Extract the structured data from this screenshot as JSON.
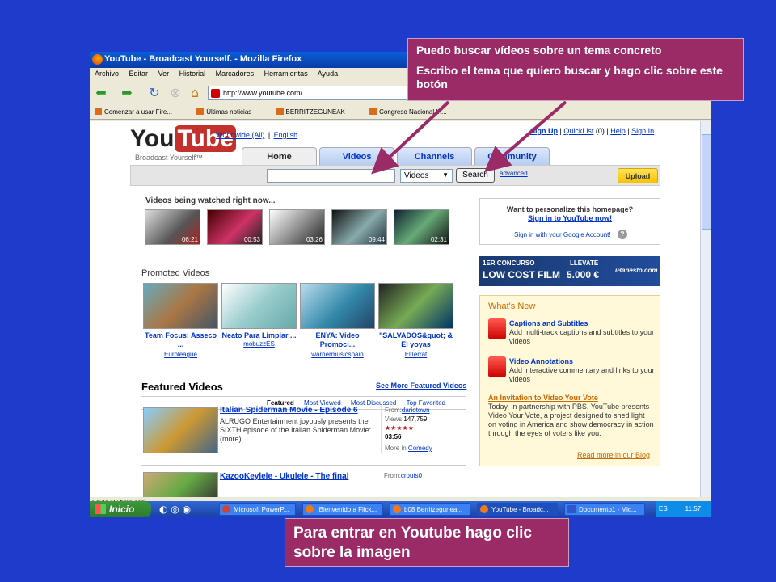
{
  "window": {
    "title": "YouTube - Broadcast Yourself. - Mozilla Firefox"
  },
  "menubar": [
    "Archivo",
    "Editar",
    "Ver",
    "Historial",
    "Marcadores",
    "Herramientas",
    "Ayuda"
  ],
  "address": {
    "url": "http://www.youtube.com/"
  },
  "bookmarks": [
    "Comenzar a usar Fire...",
    "Últimas noticias",
    "BERRITZEGUNEAK",
    "Congreso Nacional In..."
  ],
  "header": {
    "logo_you": "You",
    "logo_tube": "Tube",
    "slogan": "Broadcast Yourself™",
    "worldwide": "Worldwide (All)",
    "sep": "|",
    "english": "English",
    "signup": "Sign Up",
    "quicklist": "QuickList",
    "quicklist_count": "(0)",
    "help": "Help",
    "signin": "Sign In"
  },
  "tabs": [
    "Home",
    "Videos",
    "Channels",
    "Community"
  ],
  "search": {
    "category": "Videos",
    "button": "Search",
    "advanced": "advanced",
    "upload": "Upload"
  },
  "watching": {
    "heading": "Videos being watched right now...",
    "durations": [
      "06:21",
      "00:53",
      "03:26",
      "09:44",
      "02:31"
    ]
  },
  "personalize": {
    "text": "Want to personalize this homepage?",
    "signin": "Sign in to YouTube now!",
    "google": "Sign in with your Google Account!"
  },
  "promoted": {
    "heading": "Promoted Videos",
    "items": [
      {
        "title": "Team Focus: Asseco ...",
        "user": "Euroleague"
      },
      {
        "title": "Neato Para Limpiar ...",
        "user": "mobuzzES"
      },
      {
        "title": "ENYA: Video Promoci...",
        "user": "warnermusicspain"
      },
      {
        "title": "\"SALVADOS&quot; & El yoyas",
        "user": "ElTerrat"
      }
    ]
  },
  "ad": {
    "line1": "1ER CONCURSO",
    "line2": "LOW COST FILM",
    "line3": "LLÉVATE",
    "line4": "5.000 €",
    "brand": "iBanesto.com"
  },
  "featured": {
    "heading": "Featured Videos",
    "see_more": "See More Featured Videos",
    "tabs": [
      "Featured",
      "Most Viewed",
      "Most Discussed",
      "Top Favorited"
    ],
    "videos": [
      {
        "title": "Italian Spiderman Movie - Episode 6",
        "desc": "ALRUGO Entertainment joyously presents the SIXTH episode of the Italian Spiderman Movie:",
        "more": "(more)",
        "from_label": "From:",
        "from": "dariotown",
        "views_label": "Views:",
        "views": "147,759",
        "stars": "★★★★★",
        "time": "03:56",
        "more_in": "More in",
        "category": "Comedy"
      },
      {
        "title": "KazooKeylele - Ukulele - The final",
        "from_label": "From:",
        "from": "crouts0"
      }
    ]
  },
  "whats_new": {
    "heading": "What's New",
    "items": [
      {
        "title": "Captions and Subtitles",
        "desc": "Add multi-track captions and subtitles to your videos"
      },
      {
        "title": "Video Annotations",
        "desc": "Add interactive commentary and links to your videos"
      }
    ],
    "invite_title": "An Invitation to Video Your Vote",
    "invite_text": "Today, in partnership with PBS, YouTube presents Video Your Vote, a project designed to shed light on voting in America and show democracy in action through the eyes of voters like you.",
    "read_more": "Read more in our Blog"
  },
  "statusbar": "Leído i3.ytimg.com",
  "taskbar": {
    "start": "Inicio",
    "items": [
      "Microsoft PowerP...",
      "¡Bienvenido a Flick...",
      "b08 Berritzegunea...",
      "YouTube - Broadc...",
      "Documento1 - Mic..."
    ],
    "lang": "ES",
    "clock": "11:57"
  },
  "callouts": {
    "top_line1": "Puedo buscar vídeos sobre un tema concreto",
    "top_line2": "Escribo el tema que quiero buscar y hago clic sobre este botón",
    "bottom": "Para entrar en Youtube hago clic sobre la imagen"
  },
  "colors": {
    "background": "#1f3bcc",
    "callout": "#9b2b66",
    "link": "#0033cc"
  }
}
